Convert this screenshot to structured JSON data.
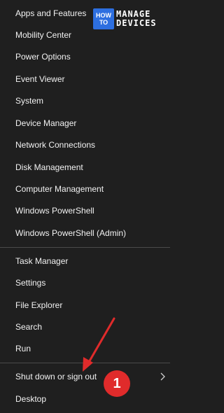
{
  "menu": {
    "items": [
      {
        "label": "Apps and Features"
      },
      {
        "label": "Mobility Center"
      },
      {
        "label": "Power Options"
      },
      {
        "label": "Event Viewer"
      },
      {
        "label": "System"
      },
      {
        "label": "Device Manager"
      },
      {
        "label": "Network Connections"
      },
      {
        "label": "Disk Management"
      },
      {
        "label": "Computer Management"
      },
      {
        "label": "Windows PowerShell"
      },
      {
        "label": "Windows PowerShell (Admin)"
      },
      {
        "label": "Task Manager"
      },
      {
        "label": "Settings"
      },
      {
        "label": "File Explorer"
      },
      {
        "label": "Search"
      },
      {
        "label": "Run"
      },
      {
        "label": "Shut down or sign out"
      },
      {
        "label": "Desktop"
      }
    ]
  },
  "logo": {
    "brand_top": "HOW",
    "brand_bottom": "TO",
    "word1": "MANAGE",
    "word2": "DEVICES"
  },
  "annotation": {
    "badge": "1",
    "color": "#e02b2b"
  },
  "icons": {
    "submenu": "chevron-right-icon"
  }
}
